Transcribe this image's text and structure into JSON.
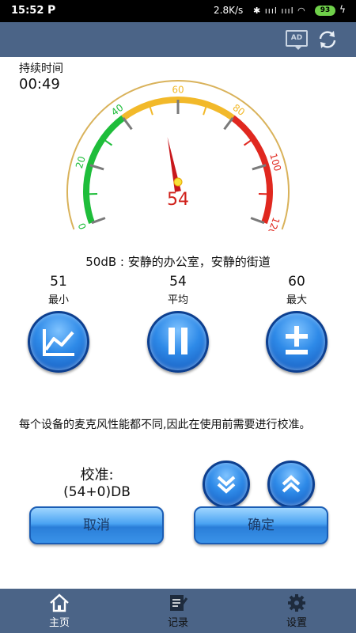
{
  "status_bar": {
    "time": "15:52",
    "app_badge": "P",
    "network_speed": "2.8K/s",
    "battery": "93"
  },
  "duration": {
    "label": "持续时间",
    "value": "00:49"
  },
  "gauge": {
    "reading": "54",
    "reading_value": 54,
    "ticks": [
      "0",
      "20",
      "40",
      "60",
      "80",
      "100",
      "120"
    ],
    "range": [
      0,
      120
    ],
    "zones": [
      {
        "from": 0,
        "to": 40,
        "color": "#1ebd3a"
      },
      {
        "from": 40,
        "to": 80,
        "color": "#f2b92a"
      },
      {
        "from": 80,
        "to": 120,
        "color": "#e0281f"
      }
    ]
  },
  "level_description": "50dB : 安静的办公室，安静的街道",
  "stats": [
    {
      "value": "51",
      "label": "最小"
    },
    {
      "value": "54",
      "label": "平均"
    },
    {
      "value": "60",
      "label": "最大"
    }
  ],
  "calibration": {
    "note": "每个设备的麦克风性能都不同,因此在使用前需要进行校准。",
    "label": "校准:",
    "value": "(54+0)DB",
    "cancel_label": "取消",
    "confirm_label": "确定"
  },
  "nav": [
    {
      "label": "主页",
      "icon": "home-icon"
    },
    {
      "label": "记录",
      "icon": "notepad-icon"
    },
    {
      "label": "设置",
      "icon": "gear-icon"
    }
  ],
  "colors": {
    "bar": "#4b6487",
    "needle": "#d0201a",
    "button_blue": "#2e8ae8"
  }
}
